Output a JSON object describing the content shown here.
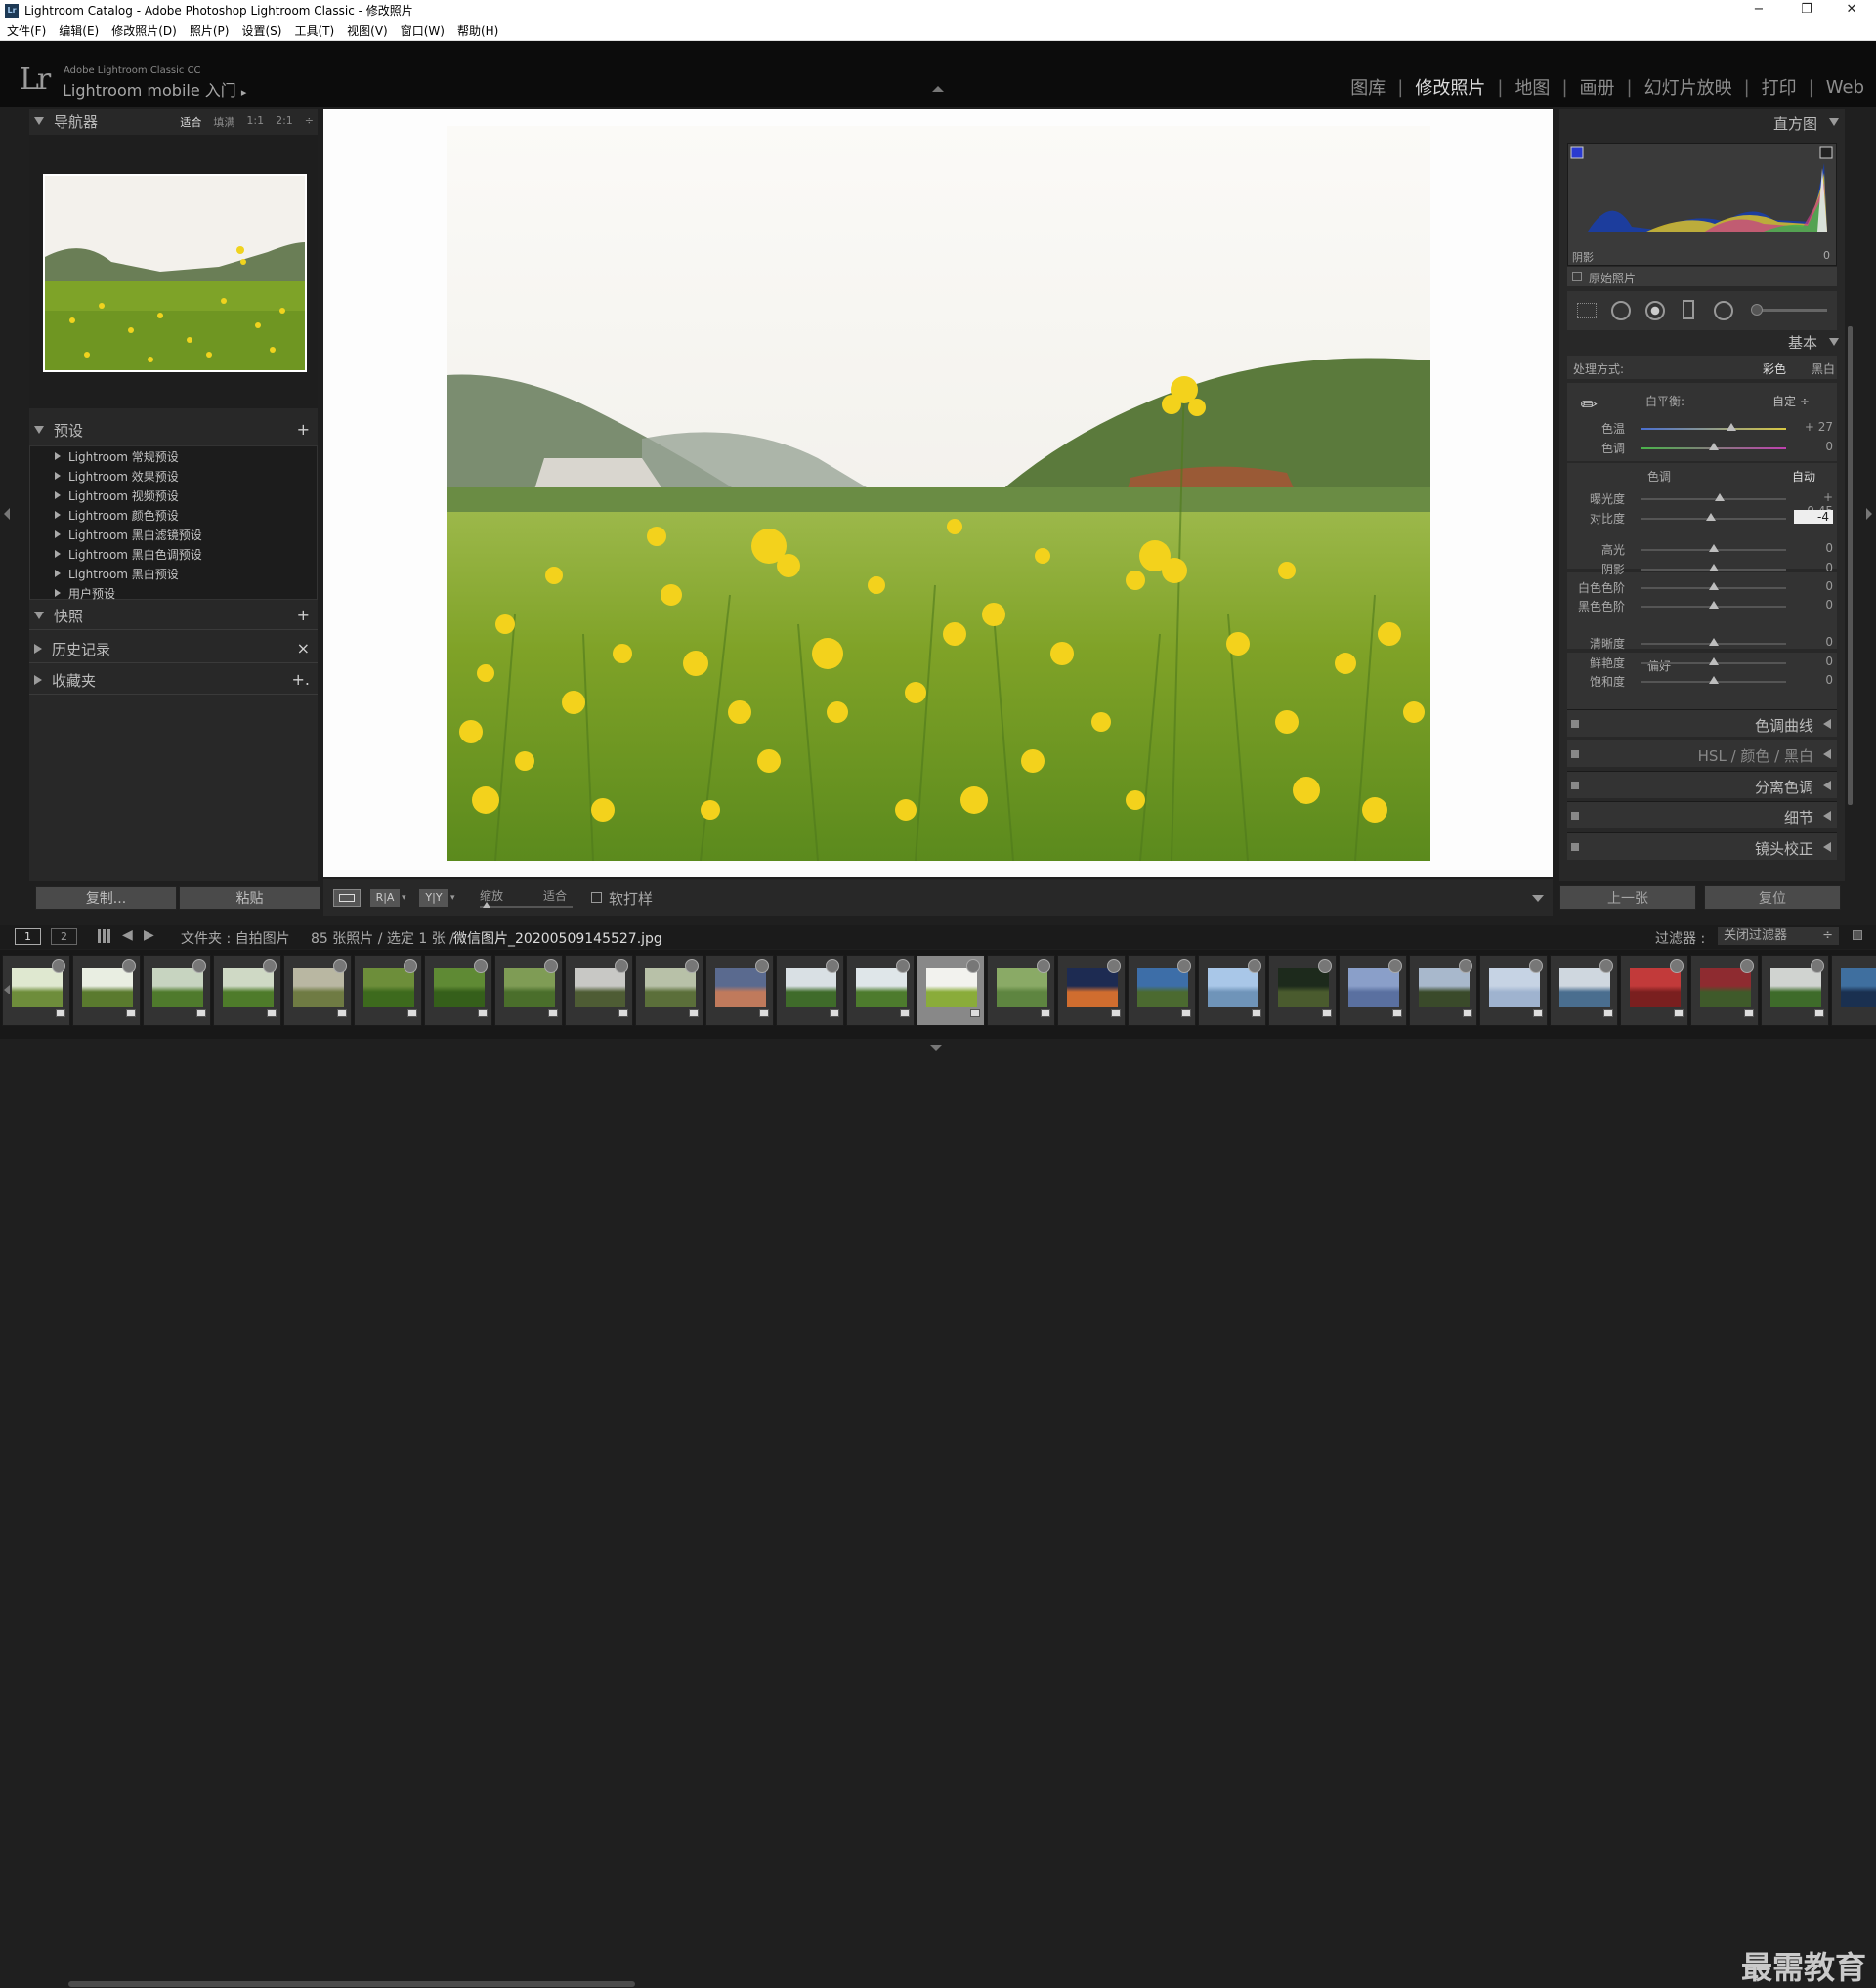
{
  "window": {
    "title": "Lightroom Catalog - Adobe Photoshop Lightroom Classic - 修改照片",
    "icon": "Lr",
    "controls": {
      "minimize": "−",
      "restore": "❐",
      "close": "✕"
    }
  },
  "menu": [
    "文件(F)",
    "编辑(E)",
    "修改照片(D)",
    "照片(P)",
    "设置(S)",
    "工具(T)",
    "视图(V)",
    "窗口(W)",
    "帮助(H)"
  ],
  "identity": {
    "logo": "Lr",
    "line1": "Adobe Lightroom Classic CC",
    "line2": "Lightroom mobile 入门",
    "line2_arrow": "▸"
  },
  "modules": [
    "图库",
    "修改照片",
    "地图",
    "画册",
    "幻灯片放映",
    "打印",
    "Web"
  ],
  "modules_active": "修改照片",
  "left_panel": {
    "navigator": {
      "title": "导航器",
      "zoom_options": [
        "适合",
        "填满",
        "1:1",
        "2:1"
      ],
      "zoom_active": "适合"
    },
    "presets": {
      "title": "预设",
      "add": "+",
      "items": [
        "Lightroom 常规预设",
        "Lightroom 效果预设",
        "Lightroom 视频预设",
        "Lightroom 颜色预设",
        "Lightroom 黑白滤镜预设",
        "Lightroom 黑白色调预设",
        "Lightroom 黑白预设",
        "用户预设"
      ]
    },
    "snapshots": {
      "title": "快照",
      "add": "+"
    },
    "history": {
      "title": "历史记录",
      "clear": "×"
    },
    "collections": {
      "title": "收藏夹",
      "add": "+."
    },
    "buttons": {
      "copy": "复制...",
      "paste": "粘贴"
    }
  },
  "toolbar": {
    "ra": "R|A",
    "yy": "Y|Y",
    "zoom_label": "缩放",
    "zoom_value": "适合",
    "softproof": "软打样"
  },
  "right_panel": {
    "histogram": {
      "title": "直方图",
      "shadow_label": "阴影",
      "shadow_value": "0",
      "original_label": "原始照片"
    },
    "basic": {
      "title": "基本",
      "treatment_label": "处理方式:",
      "treatment_color": "彩色",
      "treatment_bw": "黑白",
      "wb_label": "白平衡:",
      "wb_value": "自定 ÷",
      "tone_label": "色调",
      "auto_label": "自动",
      "presence_label": "偏好",
      "sliders_wb": [
        {
          "label": "色温",
          "value": "+ 27",
          "pos": 0.62
        },
        {
          "label": "色调",
          "value": "0",
          "pos": 0.5
        }
      ],
      "sliders_tone": [
        {
          "label": "曝光度",
          "value": "+ 0.45",
          "pos": 0.54
        },
        {
          "label": "对比度",
          "value": "-4",
          "pos": 0.48
        }
      ],
      "sliders_tone2": [
        {
          "label": "高光",
          "value": "0",
          "pos": 0.5
        },
        {
          "label": "阴影",
          "value": "0",
          "pos": 0.5
        },
        {
          "label": "白色色阶",
          "value": "0",
          "pos": 0.5
        },
        {
          "label": "黑色色阶",
          "value": "0",
          "pos": 0.5
        }
      ],
      "sliders_presence": [
        {
          "label": "清晰度",
          "value": "0",
          "pos": 0.5
        },
        {
          "label": "鲜艳度",
          "value": "0",
          "pos": 0.5
        },
        {
          "label": "饱和度",
          "value": "0",
          "pos": 0.5
        }
      ]
    },
    "collapsed_panels": [
      "色调曲线",
      "HSL  /  颜色  /  黑白",
      "分离色调",
      "细节",
      "镜头校正"
    ],
    "buttons": {
      "previous": "上一张",
      "reset": "复位"
    }
  },
  "filmstrip_bar": {
    "page1": "1",
    "page2": "2",
    "source": "文件夹 : 自拍图片",
    "count": "85 张照片 / 选定 1 张 /",
    "filename": "微信图片_20200509145527.jpg",
    "filter_label": "过滤器 :",
    "filter_value": "关闭过滤器"
  },
  "filmstrip": {
    "selected_index": 13,
    "thumb_colors": [
      [
        "#dfe8d0",
        "#6e8d3b"
      ],
      [
        "#e9eee2",
        "#5a7a2e"
      ],
      [
        "#c7d4c0",
        "#4f7a2c"
      ],
      [
        "#cfd9c5",
        "#4e7b2a"
      ],
      [
        "#b9b7a2",
        "#6f7b43"
      ],
      [
        "#6d8e3a",
        "#3d6a1d"
      ],
      [
        "#5f8a34",
        "#355f1a"
      ],
      [
        "#7f9c55",
        "#4a6e2b"
      ],
      [
        "#c8c8c5",
        "#4e5c34"
      ],
      [
        "#b8c1a8",
        "#5b6f3a"
      ],
      [
        "#5a6a8f",
        "#c07a5c"
      ],
      [
        "#d9e0e4",
        "#3f6b2a"
      ],
      [
        "#dfe6e9",
        "#4d7b2d"
      ],
      [
        "#f2f2ee",
        "#8aac3a"
      ],
      [
        "#8aaa66",
        "#5e8540"
      ],
      [
        "#1d2b52",
        "#d06d2f"
      ],
      [
        "#3d6ea8",
        "#4b6a30"
      ],
      [
        "#a9c7e8",
        "#6f94b9"
      ],
      [
        "#1d2a1c",
        "#4a5b2e"
      ],
      [
        "#8a9fc9",
        "#5a70a0"
      ],
      [
        "#a8b8cc",
        "#3a4a2a"
      ],
      [
        "#c6d3e4",
        "#9fb3cf"
      ],
      [
        "#cfd7df",
        "#4a6e8f"
      ],
      [
        "#c23a3a",
        "#7a1f1f"
      ],
      [
        "#8e2b30",
        "#3f5a2a"
      ],
      [
        "#d0d3d0",
        "#3e6b2a"
      ],
      [
        "#3f6f9f",
        "#1a3050"
      ]
    ]
  },
  "watermark": "最需教育"
}
